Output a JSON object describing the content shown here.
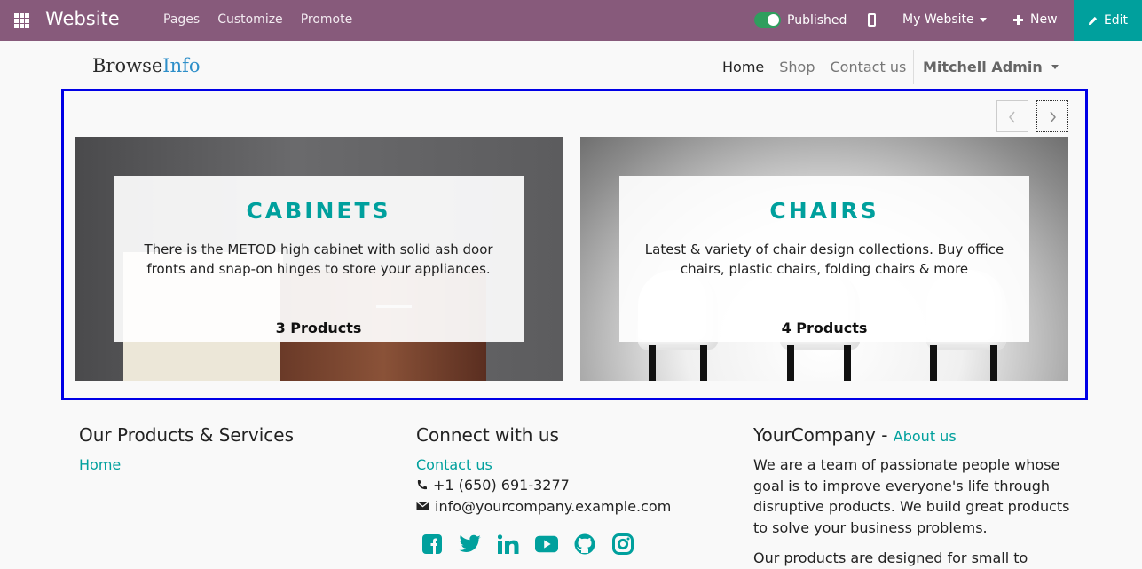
{
  "topbar": {
    "app_name": "Website",
    "menu": [
      "Pages",
      "Customize",
      "Promote"
    ],
    "published_label": "Published",
    "site_selector": "My Website",
    "new_label": "New",
    "edit_label": "Edit",
    "colors": {
      "bar": "#875a7b",
      "edit": "#00a09d",
      "toggle_on": "#2f9e5e"
    }
  },
  "site": {
    "logo_part1": "Browse",
    "logo_part2": "Info",
    "nav": [
      "Home",
      "Shop",
      "Contact us"
    ],
    "user": "Mitchell Admin"
  },
  "categories": [
    {
      "title": "CABINETS",
      "description": "There is the METOD high cabinet with solid ash door fronts and snap-on hinges to store your appliances.",
      "count": "3 Products"
    },
    {
      "title": "CHAIRS",
      "description": "Latest & variety of chair design collections. Buy office chairs, plastic chairs, folding chairs & more",
      "count": "4 Products"
    }
  ],
  "footer": {
    "col1_title": "Our Products & Services",
    "col1_link": "Home",
    "col2_title": "Connect with us",
    "col2_link": "Contact us",
    "phone": "+1 (650) 691-3277",
    "email": "info@yourcompany.example.com",
    "col3_title": "YourCompany",
    "col3_about": "About us",
    "col3_text": "We are a team of passionate people whose goal is to improve everyone's life through disruptive products. We build great products to solve your business problems.",
    "col3_text2": "Our products are designed for small to",
    "social_icons": [
      "facebook-icon",
      "twitter-icon",
      "linkedin-icon",
      "youtube-icon",
      "github-icon",
      "instagram-icon"
    ],
    "accent": "#00a09d"
  }
}
